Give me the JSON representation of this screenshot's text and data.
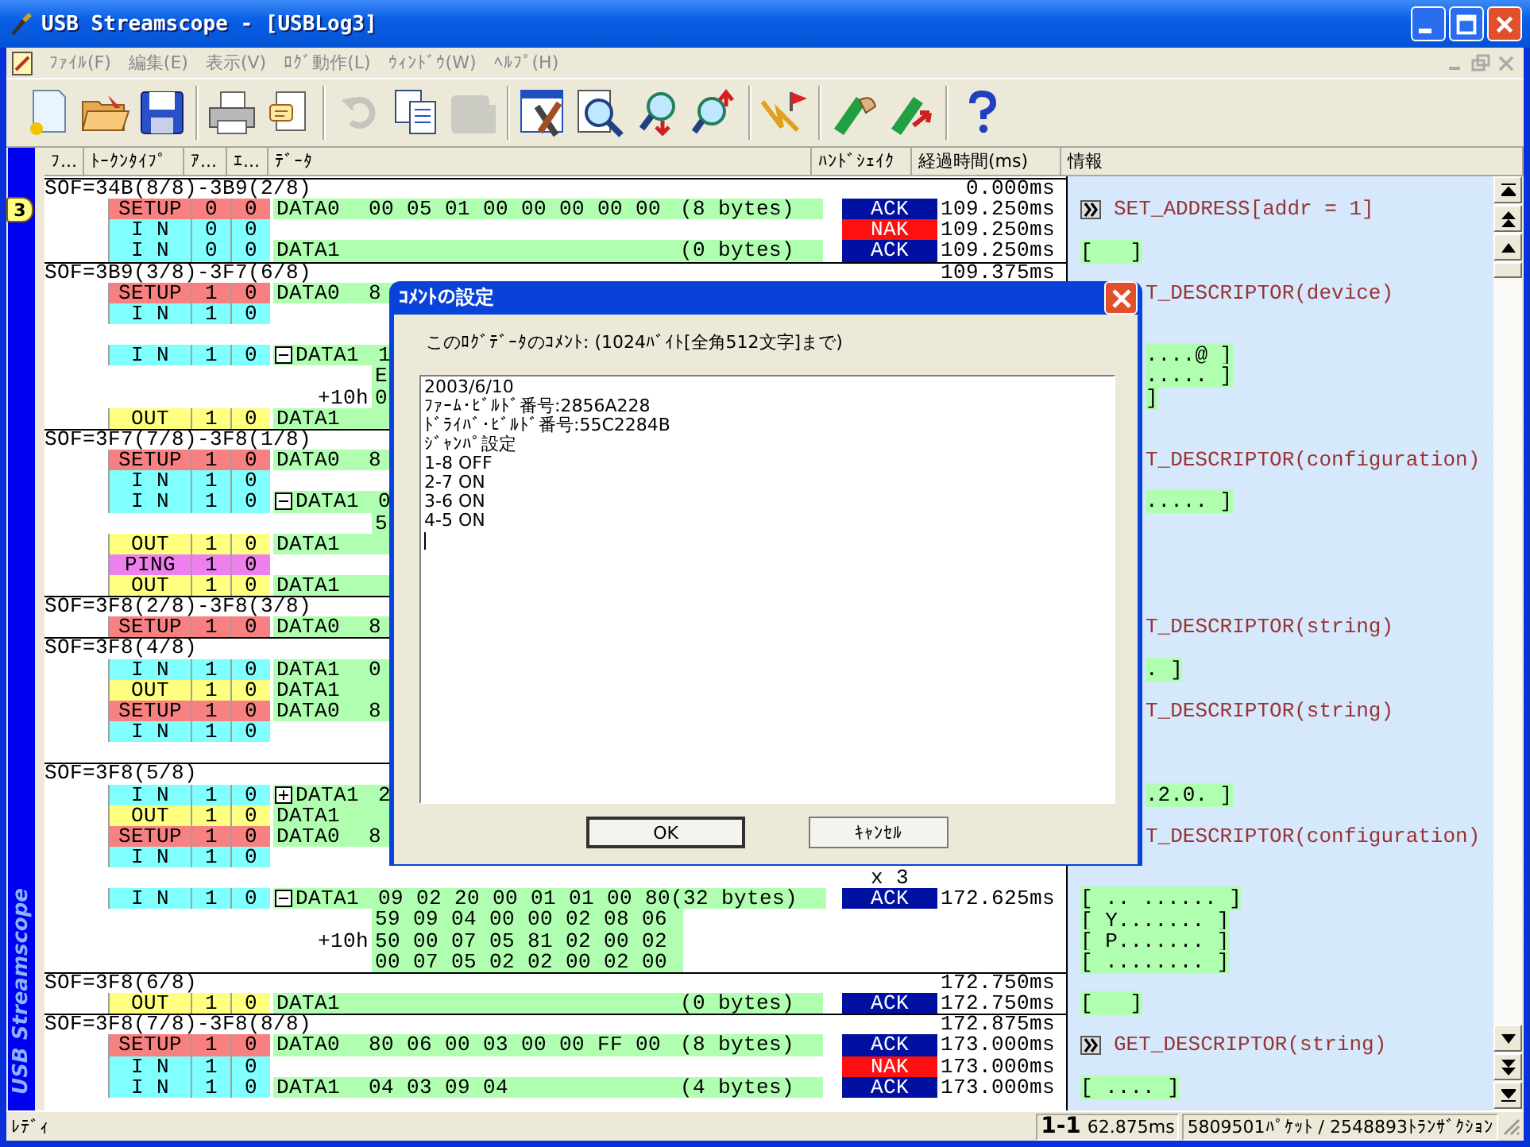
{
  "window": {
    "title": "USB Streamscope - [USBLog3]"
  },
  "menu": [
    {
      "label": "ﾌｧｲﾙ(F)",
      "disabled": true
    },
    {
      "label": "編集(E)",
      "disabled": true
    },
    {
      "label": "表示(V)",
      "disabled": true
    },
    {
      "label": "ﾛｸﾞ動作(L)",
      "disabled": true
    },
    {
      "label": "ｳｨﾝﾄﾞｳ(W)",
      "disabled": true
    },
    {
      "label": "ﾍﾙﾌﾟ(H)",
      "disabled": true
    }
  ],
  "toolbar": [
    {
      "kind": "new",
      "disabled": false
    },
    {
      "kind": "open",
      "disabled": false
    },
    {
      "kind": "save",
      "disabled": false
    },
    {
      "kind": "separator"
    },
    {
      "kind": "print",
      "disabled": false
    },
    {
      "kind": "comment",
      "disabled": false
    },
    {
      "kind": "separator"
    },
    {
      "kind": "undo",
      "disabled": true
    },
    {
      "kind": "copy",
      "disabled": false
    },
    {
      "kind": "paste",
      "disabled": true
    },
    {
      "kind": "separator"
    },
    {
      "kind": "tools",
      "disabled": false
    },
    {
      "kind": "search",
      "disabled": false
    },
    {
      "kind": "find_down",
      "disabled": false
    },
    {
      "kind": "find_up",
      "disabled": false
    },
    {
      "kind": "separator"
    },
    {
      "kind": "trigger",
      "disabled": false
    },
    {
      "kind": "separator"
    },
    {
      "kind": "mark_left",
      "disabled": false
    },
    {
      "kind": "mark_right",
      "disabled": false
    },
    {
      "kind": "separator"
    },
    {
      "kind": "help",
      "disabled": false
    }
  ],
  "log": {
    "columns": [
      "ﾌ...",
      "ﾄｰｸﾝﾀｲﾌﾟ",
      "ｱ...",
      "ｴ...",
      "ﾃﾞｰﾀ",
      "ﾊﾝﾄﾞｼｪｲｸ",
      "経過時間(ms)",
      "情報"
    ],
    "side_label": "USB Streamscope",
    "rows": [
      {
        "kind": "sof",
        "sof": "SOF=34B(8/8)-3B9(2/8)",
        "time": "0.000ms"
      },
      {
        "kind": "packet",
        "marker": "3",
        "token": {
          "label": "SETUP",
          "kind": "setup"
        },
        "addr": "0",
        "ep": "0",
        "pid": "DATA0",
        "data": "00 05 01 00 00 00 00 00",
        "bytes": "(8 bytes)",
        "handshake": {
          "label": "ACK",
          "kind": "ack"
        },
        "time": "109.250ms",
        "info": {
          "kind": "command",
          "text": "SET_ADDRESS[addr = 1]",
          "clipped": false
        }
      },
      {
        "kind": "packet",
        "token": {
          "label": "I N",
          "kind": "in"
        },
        "addr": "0",
        "ep": "0",
        "handshake": {
          "label": "NAK",
          "kind": "nak"
        },
        "time": "109.250ms"
      },
      {
        "kind": "packet",
        "token": {
          "label": "I N",
          "kind": "in"
        },
        "addr": "0",
        "ep": "0",
        "pid": "DATA1",
        "bytes": "(0 bytes)",
        "handshake": {
          "label": "ACK",
          "kind": "ack"
        },
        "time": "109.250ms",
        "info": {
          "kind": "bytes",
          "text": "[   ]",
          "clipped": false
        }
      },
      {
        "kind": "sof",
        "sof": "SOF=3B9(3/8)-3F7(6/8)",
        "time": "109.375ms"
      },
      {
        "kind": "packet",
        "token": {
          "label": "SETUP",
          "kind": "setup"
        },
        "addr": "1",
        "ep": "0",
        "pid": "DATA0",
        "data": "8",
        "info": {
          "kind": "command",
          "text": "T_DESCRIPTOR(device)",
          "clipped": true
        }
      },
      {
        "kind": "packet",
        "token": {
          "label": "I N",
          "kind": "in"
        },
        "addr": "1",
        "ep": "0"
      },
      {
        "kind": "blank"
      },
      {
        "kind": "packet",
        "token": {
          "label": "I N",
          "kind": "in"
        },
        "addr": "1",
        "ep": "0",
        "expanded": true,
        "pid": "DATA1",
        "data": "1",
        "info": {
          "kind": "bytes",
          "text": "....@ ]",
          "clipped": true
        }
      },
      {
        "kind": "cont",
        "data": "E",
        "info": {
          "kind": "bytes",
          "text": "..... ]",
          "clipped": true
        }
      },
      {
        "kind": "cont",
        "offset": "+10h",
        "data": "0",
        "info": {
          "kind": "bytes",
          "text": "]",
          "clipped": true
        }
      },
      {
        "kind": "packet",
        "token": {
          "label": "OUT",
          "kind": "out"
        },
        "addr": "1",
        "ep": "0",
        "pid": "DATA1"
      },
      {
        "kind": "sof",
        "sof": "SOF=3F7(7/8)-3F8(1/8)"
      },
      {
        "kind": "packet",
        "token": {
          "label": "SETUP",
          "kind": "setup"
        },
        "addr": "1",
        "ep": "0",
        "pid": "DATA0",
        "data": "8",
        "info": {
          "kind": "command",
          "text": "T_DESCRIPTOR(configuration)",
          "clipped": true
        }
      },
      {
        "kind": "packet",
        "token": {
          "label": "I N",
          "kind": "in"
        },
        "addr": "1",
        "ep": "0"
      },
      {
        "kind": "packet",
        "token": {
          "label": "I N",
          "kind": "in"
        },
        "addr": "1",
        "ep": "0",
        "expanded": true,
        "pid": "DATA1",
        "data": "0",
        "info": {
          "kind": "bytes",
          "text": "..... ]",
          "clipped": true
        }
      },
      {
        "kind": "cont",
        "data": "5"
      },
      {
        "kind": "packet",
        "token": {
          "label": "OUT",
          "kind": "out"
        },
        "addr": "1",
        "ep": "0",
        "pid": "DATA1"
      },
      {
        "kind": "packet",
        "token": {
          "label": "PING",
          "kind": "ping"
        },
        "addr": "1",
        "ep": "0"
      },
      {
        "kind": "packet",
        "token": {
          "label": "OUT",
          "kind": "out"
        },
        "addr": "1",
        "ep": "0",
        "pid": "DATA1"
      },
      {
        "kind": "sof",
        "sof": "SOF=3F8(2/8)-3F8(3/8)"
      },
      {
        "kind": "packet",
        "token": {
          "label": "SETUP",
          "kind": "setup"
        },
        "addr": "1",
        "ep": "0",
        "pid": "DATA0",
        "data": "8",
        "info": {
          "kind": "command",
          "text": "T_DESCRIPTOR(string)",
          "clipped": true
        }
      },
      {
        "kind": "sof",
        "sof": "SOF=3F8(4/8)"
      },
      {
        "kind": "packet",
        "token": {
          "label": "I N",
          "kind": "in"
        },
        "addr": "1",
        "ep": "0",
        "pid": "DATA1",
        "data": "0",
        "info": {
          "kind": "bytes",
          "text": ". ]",
          "clipped": true
        }
      },
      {
        "kind": "packet",
        "token": {
          "label": "OUT",
          "kind": "out"
        },
        "addr": "1",
        "ep": "0",
        "pid": "DATA1"
      },
      {
        "kind": "packet",
        "token": {
          "label": "SETUP",
          "kind": "setup"
        },
        "addr": "1",
        "ep": "0",
        "pid": "DATA0",
        "data": "8",
        "info": {
          "kind": "command",
          "text": "T_DESCRIPTOR(string)",
          "clipped": true
        }
      },
      {
        "kind": "packet",
        "token": {
          "label": "I N",
          "kind": "in"
        },
        "addr": "1",
        "ep": "0"
      },
      {
        "kind": "blank"
      },
      {
        "kind": "sof",
        "sof": "SOF=3F8(5/8)"
      },
      {
        "kind": "packet",
        "token": {
          "label": "I N",
          "kind": "in"
        },
        "addr": "1",
        "ep": "0",
        "expanded": false,
        "pid": "DATA1",
        "data": "2",
        "info": {
          "kind": "bytes",
          "text": ".2.0. ]",
          "clipped": true
        }
      },
      {
        "kind": "packet",
        "token": {
          "label": "OUT",
          "kind": "out"
        },
        "addr": "1",
        "ep": "0",
        "pid": "DATA1"
      },
      {
        "kind": "packet",
        "token": {
          "label": "SETUP",
          "kind": "setup"
        },
        "addr": "1",
        "ep": "0",
        "pid": "DATA0",
        "data": "8",
        "info": {
          "kind": "command",
          "text": "T_DESCRIPTOR(configuration)",
          "clipped": true
        }
      },
      {
        "kind": "packet",
        "token": {
          "label": "I N",
          "kind": "in"
        },
        "addr": "1",
        "ep": "0"
      },
      {
        "kind": "repeat",
        "count": "x 3"
      },
      {
        "kind": "packet",
        "token": {
          "label": "I N",
          "kind": "in"
        },
        "addr": "1",
        "ep": "0",
        "expanded": true,
        "pid": "DATA1",
        "data": "09 02 20 00 01 01 00 80",
        "bytes": "(32 bytes)",
        "handshake": {
          "label": "ACK",
          "kind": "ack"
        },
        "time": "172.625ms",
        "info": {
          "kind": "bytes",
          "text": "[ .. ...... ]",
          "clipped": false
        }
      },
      {
        "kind": "cont",
        "data": "59 09 04 00 00 02 08 06",
        "info": {
          "kind": "bytes",
          "text": "[ Y....... ]",
          "clipped": false
        }
      },
      {
        "kind": "cont",
        "offset": "+10h",
        "data": "50 00 07 05 81 02 00 02",
        "info": {
          "kind": "bytes",
          "text": "[ P....... ]",
          "clipped": false
        }
      },
      {
        "kind": "cont",
        "data": "00 07 05 02 02 00 02 00",
        "info": {
          "kind": "bytes",
          "text": "[ ........ ]",
          "clipped": false
        }
      },
      {
        "kind": "sof",
        "sof": "SOF=3F8(6/8)",
        "time": "172.750ms"
      },
      {
        "kind": "packet",
        "token": {
          "label": "OUT",
          "kind": "out"
        },
        "addr": "1",
        "ep": "0",
        "pid": "DATA1",
        "bytes": "(0 bytes)",
        "handshake": {
          "label": "ACK",
          "kind": "ack"
        },
        "time": "172.750ms",
        "info": {
          "kind": "bytes",
          "text": "[   ]",
          "clipped": false
        }
      },
      {
        "kind": "sof",
        "sof": "SOF=3F8(7/8)-3F8(8/8)",
        "time": "172.875ms"
      },
      {
        "kind": "packet",
        "token": {
          "label": "SETUP",
          "kind": "setup"
        },
        "addr": "1",
        "ep": "0",
        "pid": "DATA0",
        "data": "80 06 00 03 00 00 FF 00",
        "bytes": "(8 bytes)",
        "handshake": {
          "label": "ACK",
          "kind": "ack"
        },
        "time": "173.000ms",
        "info": {
          "kind": "command",
          "text": "GET_DESCRIPTOR(string)",
          "clipped": false
        }
      },
      {
        "kind": "packet",
        "token": {
          "label": "I N",
          "kind": "in"
        },
        "addr": "1",
        "ep": "0",
        "handshake": {
          "label": "NAK",
          "kind": "nak"
        },
        "time": "173.000ms"
      },
      {
        "kind": "packet",
        "token": {
          "label": "I N",
          "kind": "in"
        },
        "addr": "1",
        "ep": "0",
        "pid": "DATA1",
        "data": "04 03 09 04",
        "bytes": "(4 bytes)",
        "handshake": {
          "label": "ACK",
          "kind": "ack"
        },
        "time": "173.000ms",
        "info": {
          "kind": "bytes",
          "text": "[ .... ]",
          "clipped": false
        }
      }
    ]
  },
  "status_bar": {
    "text": "ﾚﾃﾞｨ",
    "position": "1-1",
    "elapsed": "62.875ms",
    "counts": "5809501ﾊﾟｹｯﾄ / 2548893ﾄﾗﾝｻﾞｸｼｮﾝ"
  },
  "dialog": {
    "title": "ｺﾒﾝﾄの設定",
    "label": "このﾛｸﾞﾃﾞｰﾀのｺﾒﾝﾄ: (1024ﾊﾞｲﾄ[全角512文字]まで)",
    "value": "2003/6/10\nﾌｧｰﾑ･ﾋﾞﾙﾄﾞ番号:2856A228\nﾄﾞﾗｲﾊﾞ･ﾋﾞﾙﾄﾞ番号:55C2284B\nｼﾞｬﾝﾊﾟ設定\n1-8 OFF\n2-7 ON\n3-6 ON\n4-5 ON",
    "buttons": [
      {
        "label": "OK",
        "kind": "default"
      },
      {
        "label": "ｷｬﾝｾﾙ",
        "kind": "normal"
      }
    ]
  }
}
